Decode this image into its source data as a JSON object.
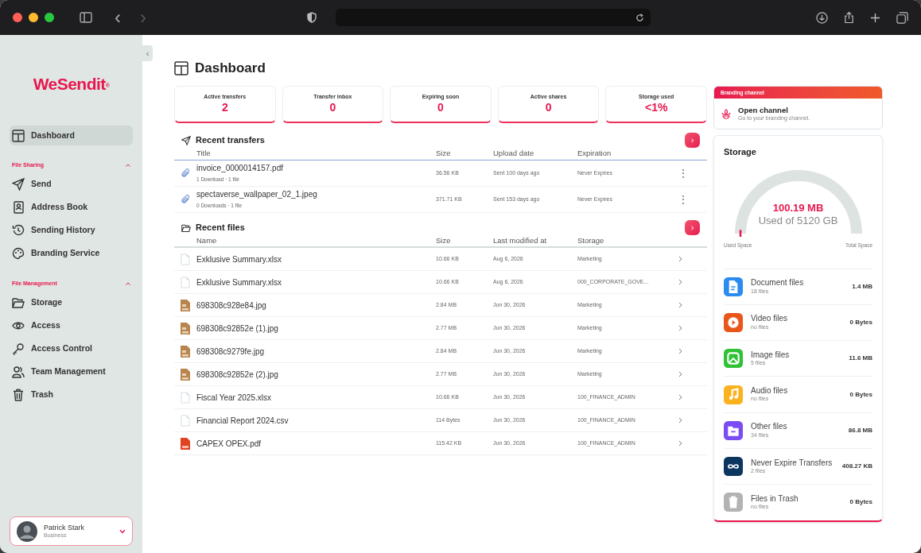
{
  "browser": {
    "back": "‹",
    "forward": "›"
  },
  "sidebar": {
    "logo": "WeSendit",
    "logo_mark": "®",
    "collapse": "‹",
    "top_items": [
      {
        "label": "Dashboard",
        "selected": true
      }
    ],
    "sections": [
      {
        "title": "File Sharing",
        "expanded": true,
        "items": [
          {
            "label": "Send",
            "selected": false
          },
          {
            "label": "Address Book",
            "selected": false
          },
          {
            "label": "Sending History",
            "selected": false
          },
          {
            "label": "Branding Service",
            "selected": false
          }
        ]
      },
      {
        "title": "File Management",
        "expanded": true,
        "items": [
          {
            "label": "Storage",
            "selected": false
          },
          {
            "label": "Access",
            "selected": false
          },
          {
            "label": "Access Control",
            "selected": false
          },
          {
            "label": "Team Management",
            "selected": false
          },
          {
            "label": "Trash",
            "selected": false
          }
        ]
      }
    ],
    "user": {
      "name": "Patrick Stark",
      "plan": "Business"
    }
  },
  "page_title": "Dashboard",
  "stats": [
    {
      "label": "Active transfers",
      "value": "2"
    },
    {
      "label": "Transfer inbox",
      "value": "0"
    },
    {
      "label": "Expiring soon",
      "value": "0"
    },
    {
      "label": "Active shares",
      "value": "0"
    },
    {
      "label": "Storage used",
      "value": "<1%"
    }
  ],
  "recent_transfers": {
    "title": "Recent transfers",
    "more": "›",
    "columns": [
      "Title",
      "Size",
      "Upload date",
      "Expiration"
    ],
    "rows": [
      {
        "title": "invoice_0000014157.pdf",
        "meta": "1 Download · 1 file",
        "size": "36.56 KB",
        "date": "Sent 100 days ago",
        "expiration": "Never Expires",
        "menu": "⋮"
      },
      {
        "title": "spectaverse_wallpaper_02_1.jpeg",
        "meta": "0 Downloads · 1 file",
        "size": "371.71 KB",
        "date": "Sent 153 days ago",
        "expiration": "Never Expires",
        "menu": "⋮"
      }
    ]
  },
  "recent_files": {
    "title": "Recent files",
    "more": "›",
    "columns": [
      "Name",
      "Size",
      "Last modified at",
      "Storage"
    ],
    "rows": [
      {
        "kind": "sheet",
        "name": "Exklusive Summary.xlsx",
        "size": "10.66 KB",
        "modified": "Aug 6, 2026",
        "storage": "Marketing"
      },
      {
        "kind": "sheet",
        "name": "Exklusive Summary.xlsx",
        "size": "10.66 KB",
        "modified": "Aug 6, 2026",
        "storage": "000_CORPORATE_GOVE..."
      },
      {
        "kind": "image",
        "name": "698308c928e84.jpg",
        "size": "2.84 MB",
        "modified": "Jun 30, 2026",
        "storage": "Marketing"
      },
      {
        "kind": "image",
        "name": "698308c92852e (1).jpg",
        "size": "2.77 MB",
        "modified": "Jun 30, 2026",
        "storage": "Marketing"
      },
      {
        "kind": "image",
        "name": "698308c9279fe.jpg",
        "size": "2.84 MB",
        "modified": "Jun 30, 2026",
        "storage": "Marketing"
      },
      {
        "kind": "image",
        "name": "698308c92852e (2).jpg",
        "size": "2.77 MB",
        "modified": "Jun 30, 2026",
        "storage": "Marketing"
      },
      {
        "kind": "sheet",
        "name": "Fiscal Year 2025.xlsx",
        "size": "10.66 KB",
        "modified": "Jun 30, 2026",
        "storage": "100_FINANCE_ADMIN"
      },
      {
        "kind": "sheet",
        "name": "Financial Report 2024.csv",
        "size": "114 Bytes",
        "modified": "Jun 30, 2026",
        "storage": "100_FINANCE_ADMIN"
      },
      {
        "kind": "pdf",
        "name": "CAPEX OPEX.pdf",
        "size": "115.42 KB",
        "modified": "Jun 30, 2026",
        "storage": "100_FINANCE_ADMIN"
      }
    ]
  },
  "branding": {
    "header": "Branding channel",
    "title": "Open channel",
    "subtitle": "Go to your branding channel."
  },
  "storage": {
    "title": "Storage",
    "used": "100.19 MB",
    "of": "Used of 5120 GB",
    "level": 0.02,
    "min_label": "Used Space",
    "max_label": "Total Space",
    "categories": [
      {
        "name": "Document files",
        "count": "18 files",
        "size": "1.4 MB",
        "color": "#2b8cf0"
      },
      {
        "name": "Video files",
        "count": "no files",
        "size": "0 Bytes",
        "color": "#e8561a"
      },
      {
        "name": "Image files",
        "count": "5 files",
        "size": "11.6 MB",
        "color": "#2fc234"
      },
      {
        "name": "Audio files",
        "count": "no files",
        "size": "0 Bytes",
        "color": "#fbb21f"
      },
      {
        "name": "Other files",
        "count": "34 files",
        "size": "86.8 MB",
        "color": "#7a4df2"
      },
      {
        "name": "Never Expire Transfers",
        "count": "2 files",
        "size": "408.27 KB",
        "color": "#0c3560"
      },
      {
        "name": "Files in Trash",
        "count": "no files",
        "size": "0 Bytes",
        "color": "#b3b3b3"
      }
    ]
  }
}
